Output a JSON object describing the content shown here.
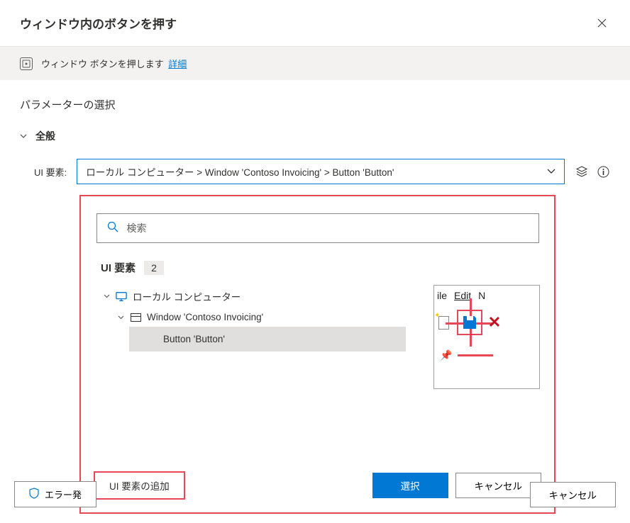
{
  "header": {
    "title": "ウィンドウ内のボタンを押す"
  },
  "info_banner": {
    "text": "ウィンドウ ボタンを押します",
    "link": "詳細"
  },
  "section": {
    "title": "パラメーターの選択",
    "accordion_general": "全般"
  },
  "field": {
    "label": "UI 要素:",
    "value": "ローカル コンピューター > Window 'Contoso Invoicing' > Button 'Button'"
  },
  "popup": {
    "search_placeholder": "検索",
    "tree_title": "UI 要素",
    "count": "2",
    "tree": {
      "root": "ローカル コンピューター",
      "window": "Window 'Contoso Invoicing'",
      "button": "Button 'Button'"
    },
    "preview_menu": {
      "file_partial": "ile",
      "edit": "Edit",
      "n": "N"
    },
    "add_button": "UI 要素の追加",
    "select_button": "選択",
    "cancel_button": "キャンセル"
  },
  "footer": {
    "error_btn": "エラー発",
    "cancel_btn": "キャンセル"
  }
}
